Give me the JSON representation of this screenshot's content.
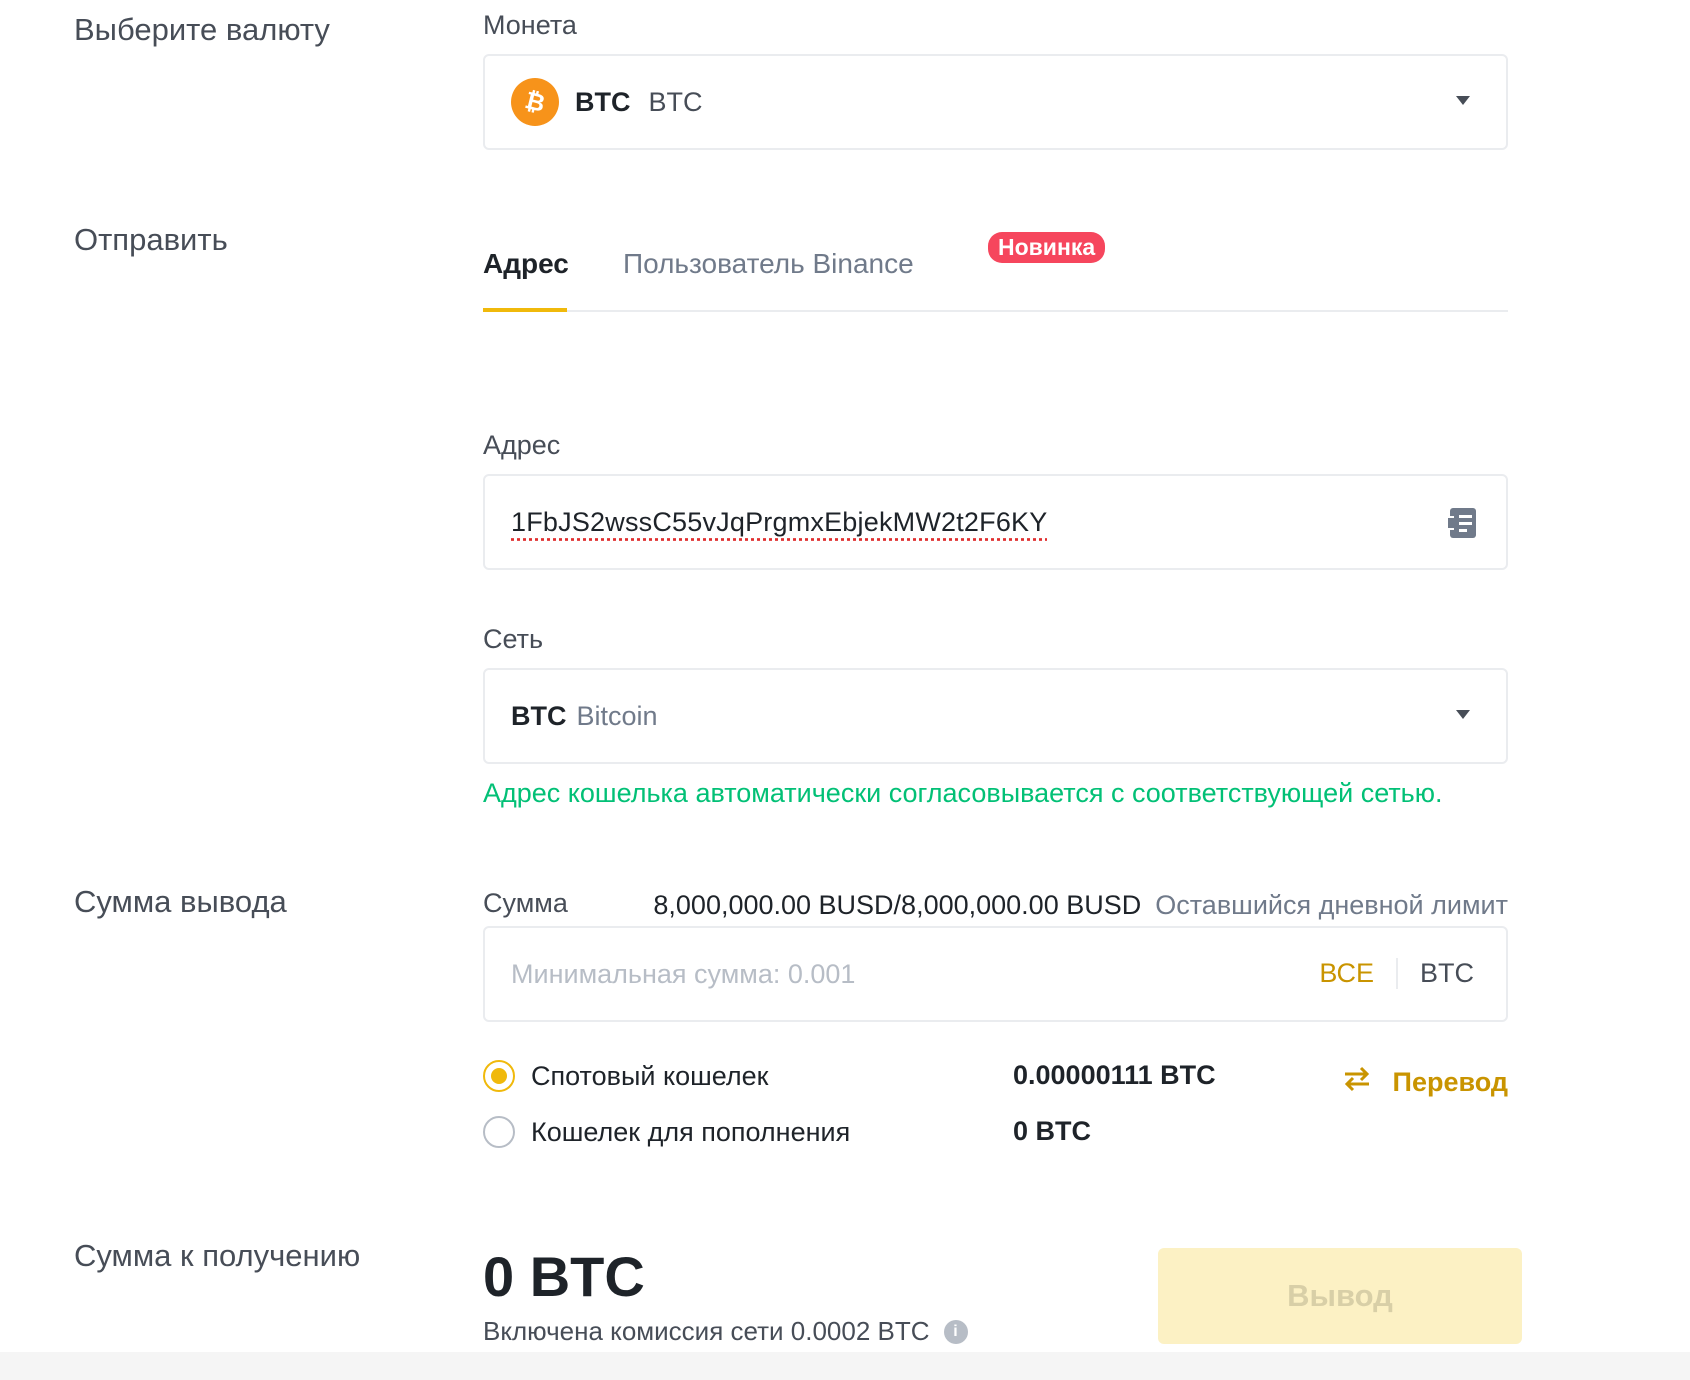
{
  "currency_section": {
    "label": "Выберите валюту",
    "field_label": "Монета",
    "selected_symbol": "BTC",
    "selected_name": "BTC",
    "icon": "bitcoin-icon",
    "accent": "#f7931a"
  },
  "send_section": {
    "label": "Отправить",
    "tabs": [
      {
        "label": "Адрес",
        "active": true
      },
      {
        "label": "Пользователь Binance",
        "active": false,
        "badge": "Новинка"
      }
    ]
  },
  "address_field": {
    "label": "Адрес",
    "value": "1FbJS2wssC55vJqPrgmxEbjekMW2t2F6KY",
    "icon": "address-book-icon"
  },
  "network_field": {
    "label": "Сеть",
    "selected_symbol": "BTC",
    "selected_name": "Bitcoin",
    "note": "Адрес кошелька автоматически согласовывается с соответствующей сетью."
  },
  "amount_section": {
    "label": "Сумма вывода",
    "field_label": "Сумма",
    "limit_value": "8,000,000.00 BUSD/8,000,000.00 BUSD",
    "limit_label": "Оставшийся дневной лимит",
    "placeholder": "Минимальная сумма: 0.001",
    "all_label": "ВСЕ",
    "unit": "BTC"
  },
  "wallets": [
    {
      "label": "Спотовый кошелек",
      "balance": "0.00000111 BTC",
      "selected": true
    },
    {
      "label": "Кошелек для пополнения",
      "balance": "0 BTC",
      "selected": false
    }
  ],
  "transfer_label": "Перевод",
  "receive_section": {
    "label": "Сумма к получению",
    "amount": "0 BTC",
    "fee_note": "Включена комиссия сети 0.0002 BTC",
    "button_label": "Вывод"
  },
  "colors": {
    "accent": "#f0b90b",
    "link": "#c99400",
    "success": "#02c076",
    "badge": "#f6465d"
  }
}
